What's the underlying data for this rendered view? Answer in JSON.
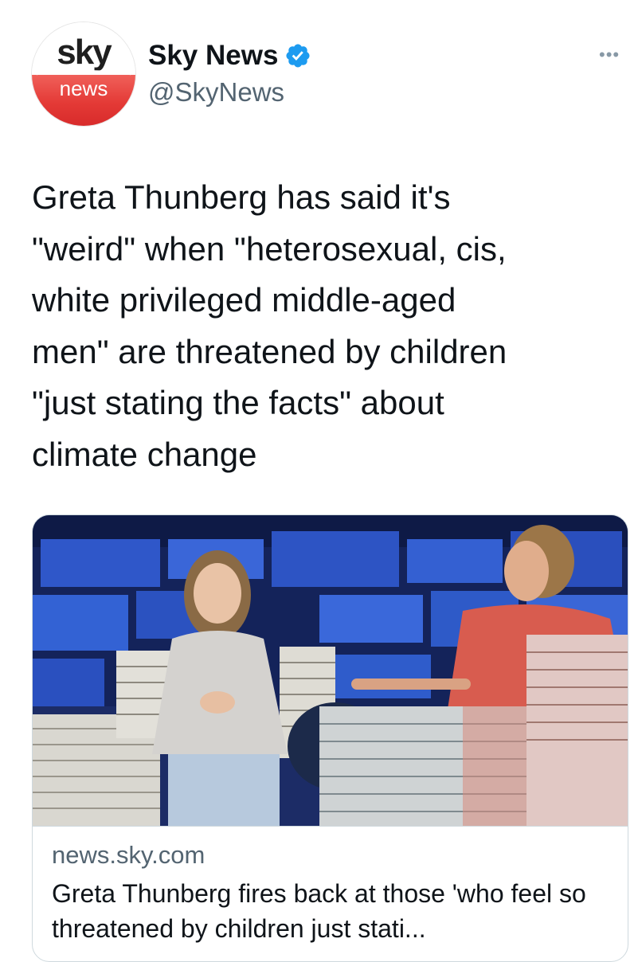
{
  "tweet": {
    "author": {
      "name": "Sky News",
      "handle": "@SkyNews",
      "verified": true,
      "avatar": {
        "logo_top": "sky",
        "logo_bottom": "news"
      },
      "avatar_colors": {
        "red": "#e43a36",
        "white": "#ffffff"
      }
    },
    "more_icon": "more-dots-icon",
    "verified_icon": "verified-badge-icon",
    "text_lines": [
      "Greta Thunberg has said it's",
      "\"weird\" when \"heterosexual, cis,",
      "white privileged middle-aged",
      "men\" are threatened by children",
      "\"just stating the facts\" about",
      "climate change"
    ],
    "link_card": {
      "domain": "news.sky.com",
      "title": "Greta Thunberg fires back at those 'who feel so threatened by children just stati..."
    }
  },
  "colors": {
    "verified_blue": "#1d9bf0",
    "text": "#0f1419",
    "secondary_text": "#536471",
    "card_border": "#cfd9de"
  }
}
